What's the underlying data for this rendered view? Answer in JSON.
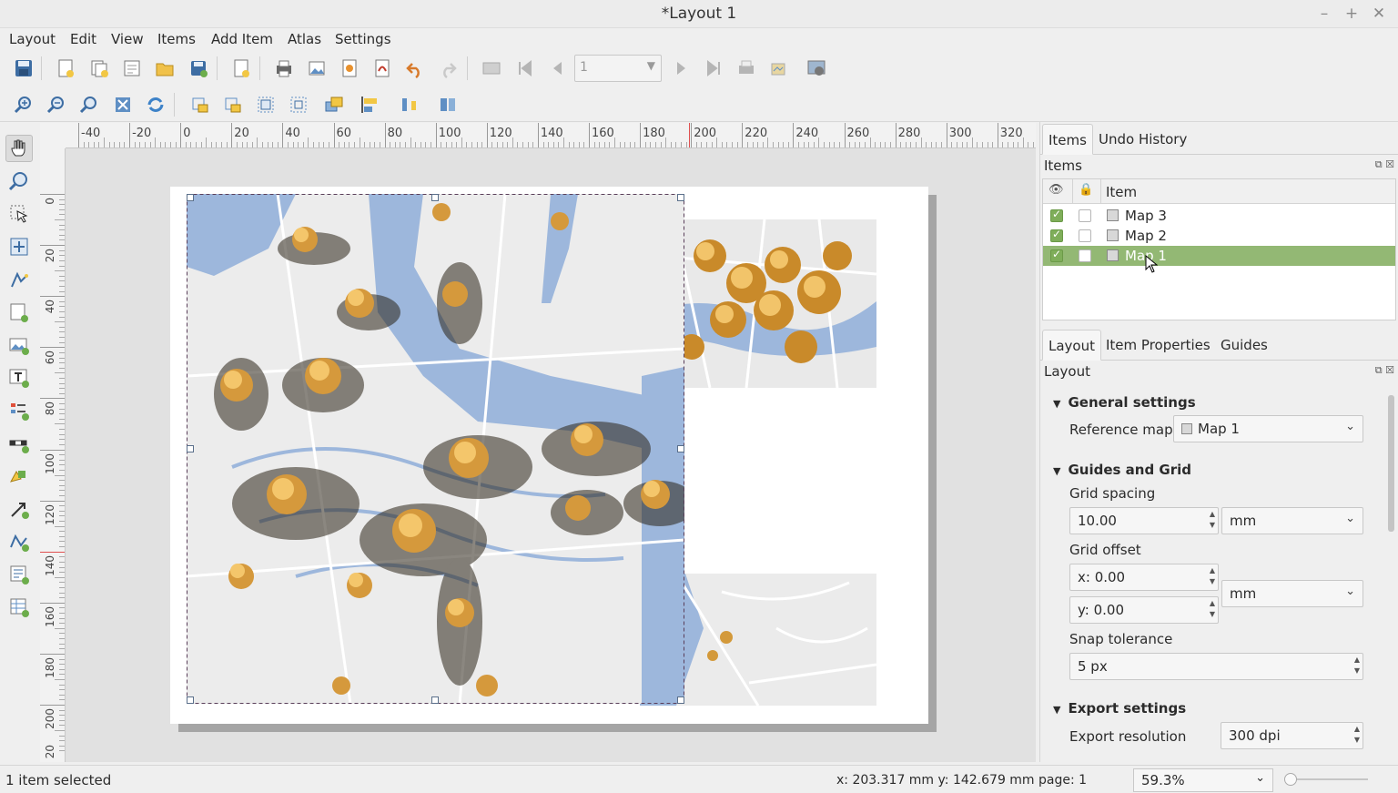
{
  "window": {
    "title": "*Layout 1",
    "controls": [
      "–",
      "+",
      "✕"
    ]
  },
  "menu": [
    "Layout",
    "Edit",
    "View",
    "Items",
    "Add Item",
    "Atlas",
    "Settings"
  ],
  "toolbar": {
    "page_number": "1"
  },
  "ruler": {
    "h_labels": [
      "-40",
      "-20",
      "0",
      "20",
      "40",
      "60",
      "80",
      "100",
      "120",
      "140",
      "160",
      "180",
      "200",
      "220",
      "240",
      "260",
      "280",
      "300",
      "320"
    ],
    "v_labels": [
      "0",
      "20",
      "40",
      "60",
      "80",
      "100",
      "120",
      "140",
      "160",
      "180",
      "200"
    ],
    "v_partial_top": "",
    "v_partial_bottom": "20"
  },
  "dock": {
    "top_tabs": [
      "Items",
      "Undo History"
    ],
    "items_panel_title": "Items",
    "items_header": "Item",
    "items": [
      {
        "label": "Map 3",
        "visible": true,
        "locked": false,
        "selected": false
      },
      {
        "label": "Map 2",
        "visible": true,
        "locked": false,
        "selected": false
      },
      {
        "label": "Map 1",
        "visible": true,
        "locked": false,
        "selected": true
      }
    ],
    "bottom_tabs": [
      "Layout",
      "Item Properties",
      "Guides"
    ],
    "layout_panel_title": "Layout",
    "general": {
      "heading": "General settings",
      "reference_map_label": "Reference map",
      "reference_map_value": "Map 1"
    },
    "guides": {
      "heading": "Guides and Grid",
      "grid_spacing_label": "Grid spacing",
      "grid_spacing_value": "10.00",
      "grid_spacing_unit": "mm",
      "grid_offset_label": "Grid offset",
      "offset_x": "x: 0.00",
      "offset_y": "y: 0.00",
      "offset_unit": "mm",
      "snap_label": "Snap tolerance",
      "snap_value": "5 px"
    },
    "export": {
      "heading": "Export settings",
      "resolution_label": "Export resolution",
      "resolution_value": "300 dpi"
    }
  },
  "status": {
    "message": "1 item selected",
    "coords": "x: 203.317 mm  y: 142.679 mm  page: 1",
    "zoom": "59.3%"
  }
}
